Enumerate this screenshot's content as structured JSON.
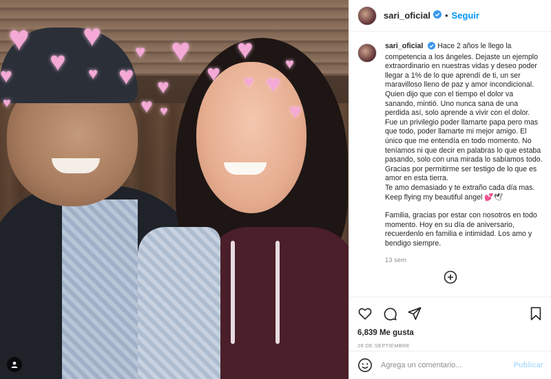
{
  "header": {
    "username": "sari_oficial",
    "separator": "•",
    "follow_label": "Seguir"
  },
  "caption": {
    "username": "sari_oficial",
    "paragraph_1": "Hace 2 años le llego la competencia a los ángeles. Dejaste un ejemplo extraordinario en nuestras vidas y deseo poder llegar a 1% de lo que aprendí de ti, un ser maravilloso lleno de paz y amor incondicional.",
    "paragraph_2": "Quien dijo que con el tiempo el dolor va sanando, mintió. Uno nunca sana de una perdida así, solo aprende a vivir con el dolor.",
    "paragraph_3": "Fue un privilegio poder llamarte papa pero mas que todo, poder llamarte mi mejor amigo. El único que me entendía en todo momento. No teníamos ni que decir en palabras lo que estaba pasando, solo con una mirada lo sabíamos todo.",
    "paragraph_4": "Gracias por permitirme ser testigo de lo que es amor en esta tierra.",
    "paragraph_5": "Te amo demasiado y te extraño cada día mas.",
    "paragraph_6": "Keep flying my beautiful angel 💕🕊",
    "paragraph_7": "Familia, gracias por estar con nosotros en todo momento. Hoy en su día de aniversario, recuerdenlo en familia e intimidad. Los amo y bendigo siempre."
  },
  "time_ago": "13 sem",
  "likes_text": "6,839 Me gusta",
  "post_date": "28 DE SEPTIEMBRE",
  "comment": {
    "placeholder": "Agrega un comentario...",
    "publish_label": "Publicar"
  },
  "colors": {
    "accent": "#0095f6",
    "publish_disabled": "#b2dffc",
    "heart_filter": "#f4a9d6"
  }
}
